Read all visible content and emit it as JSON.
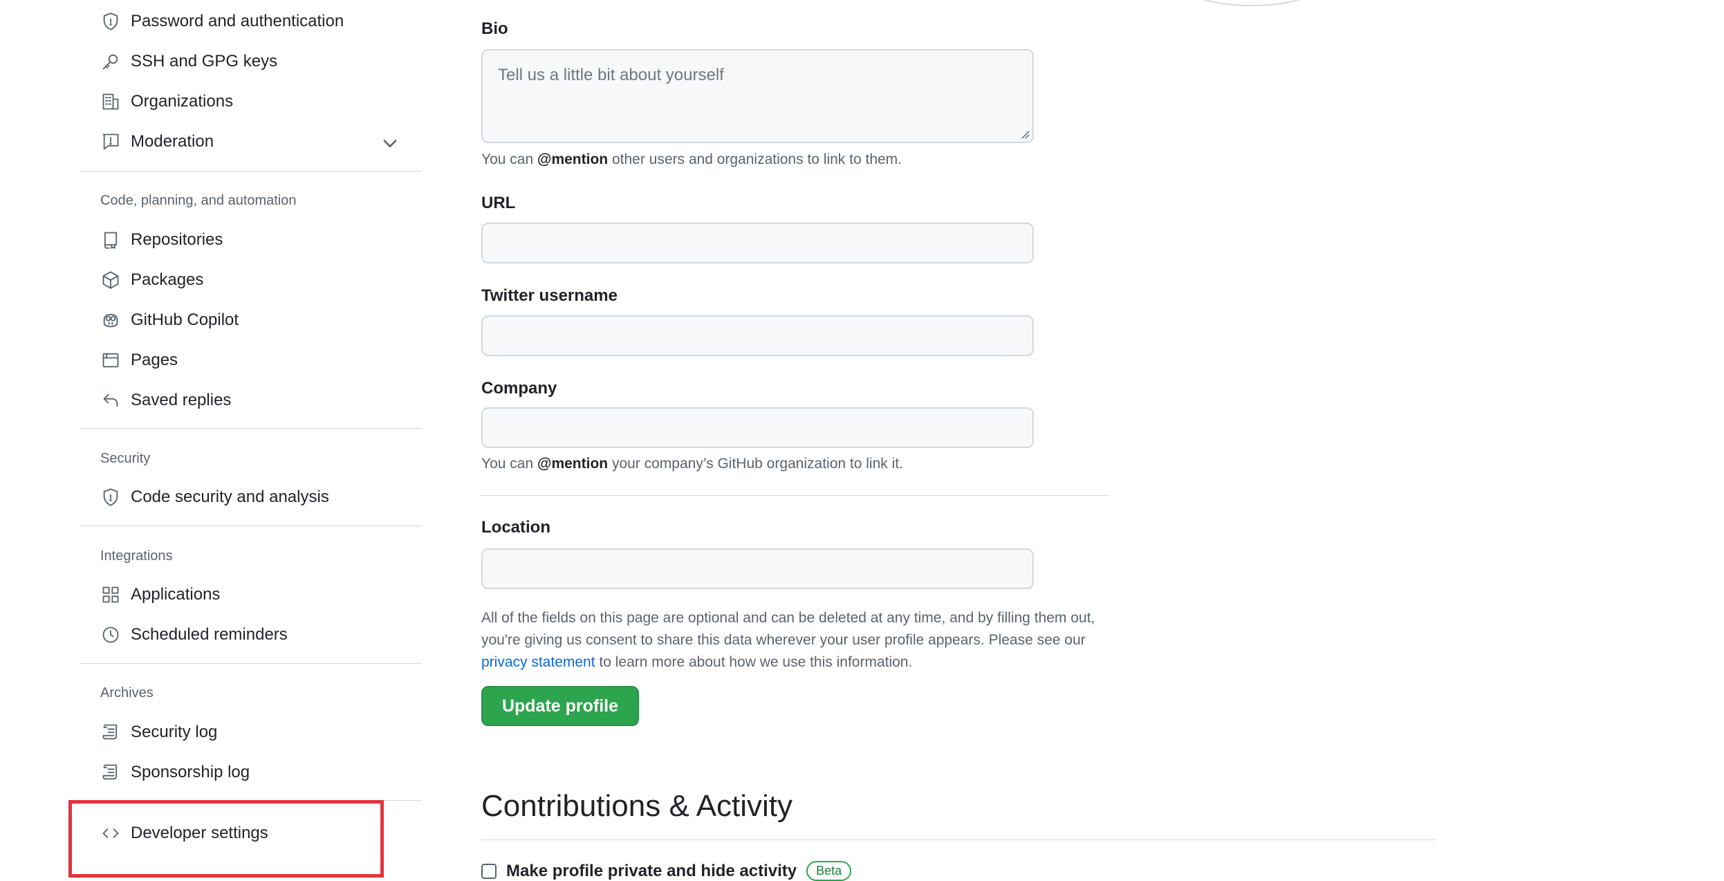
{
  "sidebar": {
    "top_items": [
      {
        "label": "Password and authentication",
        "icon": "shield-lock-icon"
      },
      {
        "label": "SSH and GPG keys",
        "icon": "key-icon"
      },
      {
        "label": "Organizations",
        "icon": "organization-icon"
      },
      {
        "label": "Moderation",
        "icon": "report-icon"
      }
    ],
    "sections": [
      {
        "heading": "Code, planning, and automation",
        "items": [
          {
            "label": "Repositories",
            "icon": "repo-icon"
          },
          {
            "label": "Packages",
            "icon": "package-icon"
          },
          {
            "label": "GitHub Copilot",
            "icon": "copilot-icon"
          },
          {
            "label": "Pages",
            "icon": "browser-icon"
          },
          {
            "label": "Saved replies",
            "icon": "reply-icon"
          }
        ]
      },
      {
        "heading": "Security",
        "items": [
          {
            "label": "Code security and analysis",
            "icon": "shield-lock-icon"
          }
        ]
      },
      {
        "heading": "Integrations",
        "items": [
          {
            "label": "Applications",
            "icon": "apps-icon"
          },
          {
            "label": "Scheduled reminders",
            "icon": "clock-icon"
          }
        ]
      },
      {
        "heading": "Archives",
        "items": [
          {
            "label": "Security log",
            "icon": "log-icon"
          },
          {
            "label": "Sponsorship log",
            "icon": "log-icon"
          }
        ]
      }
    ],
    "developer": {
      "label": "Developer settings",
      "icon": "code-icon"
    }
  },
  "form": {
    "bio": {
      "label": "Bio",
      "placeholder": "Tell us a little bit about yourself",
      "help_pre": "You can ",
      "help_mention": "@mention",
      "help_post": " other users and organizations to link to them."
    },
    "url": {
      "label": "URL"
    },
    "twitter": {
      "label": "Twitter username"
    },
    "company": {
      "label": "Company",
      "help_pre": "You can ",
      "help_mention": "@mention",
      "help_post": " your company’s GitHub organization to link it."
    },
    "location": {
      "label": "Location"
    },
    "consent": {
      "pre": "All of the fields on this page are optional and can be deleted at any time, and by filling them out, you're giving us consent to share this data wherever your user profile appears. Please see our ",
      "link": "privacy statement",
      "post": " to learn more about how we use this information."
    },
    "submit": "Update profile"
  },
  "contributions": {
    "title": "Contributions & Activity",
    "private_label": "Make profile private and hide activity",
    "badge": "Beta"
  },
  "colors": {
    "accent_green": "#2da44e",
    "link_blue": "#0969da",
    "highlight_red": "#e5333d"
  }
}
